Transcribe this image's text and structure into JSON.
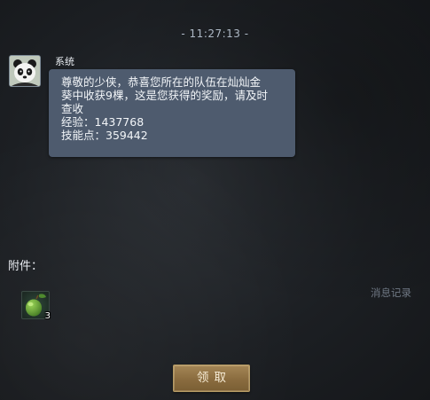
{
  "timestamp": "- 11:27:13 -",
  "message": {
    "sender": "系统",
    "lines": [
      "尊敬的少侠，恭喜您所在的队伍在灿灿金",
      "葵中收获9棵，这是您获得的奖励，请及时",
      "查收",
      "经验：1437768",
      "技能点：359442"
    ]
  },
  "attachments": {
    "label": "附件：",
    "items": [
      {
        "icon": "green-fruit-icon",
        "count": "3"
      }
    ]
  },
  "message_record_label": "消息记录",
  "claim_button_label": "领取",
  "colors": {
    "bubble": "#4e5b6e",
    "button": "#8a6c3f",
    "background": "#1c1f23"
  }
}
